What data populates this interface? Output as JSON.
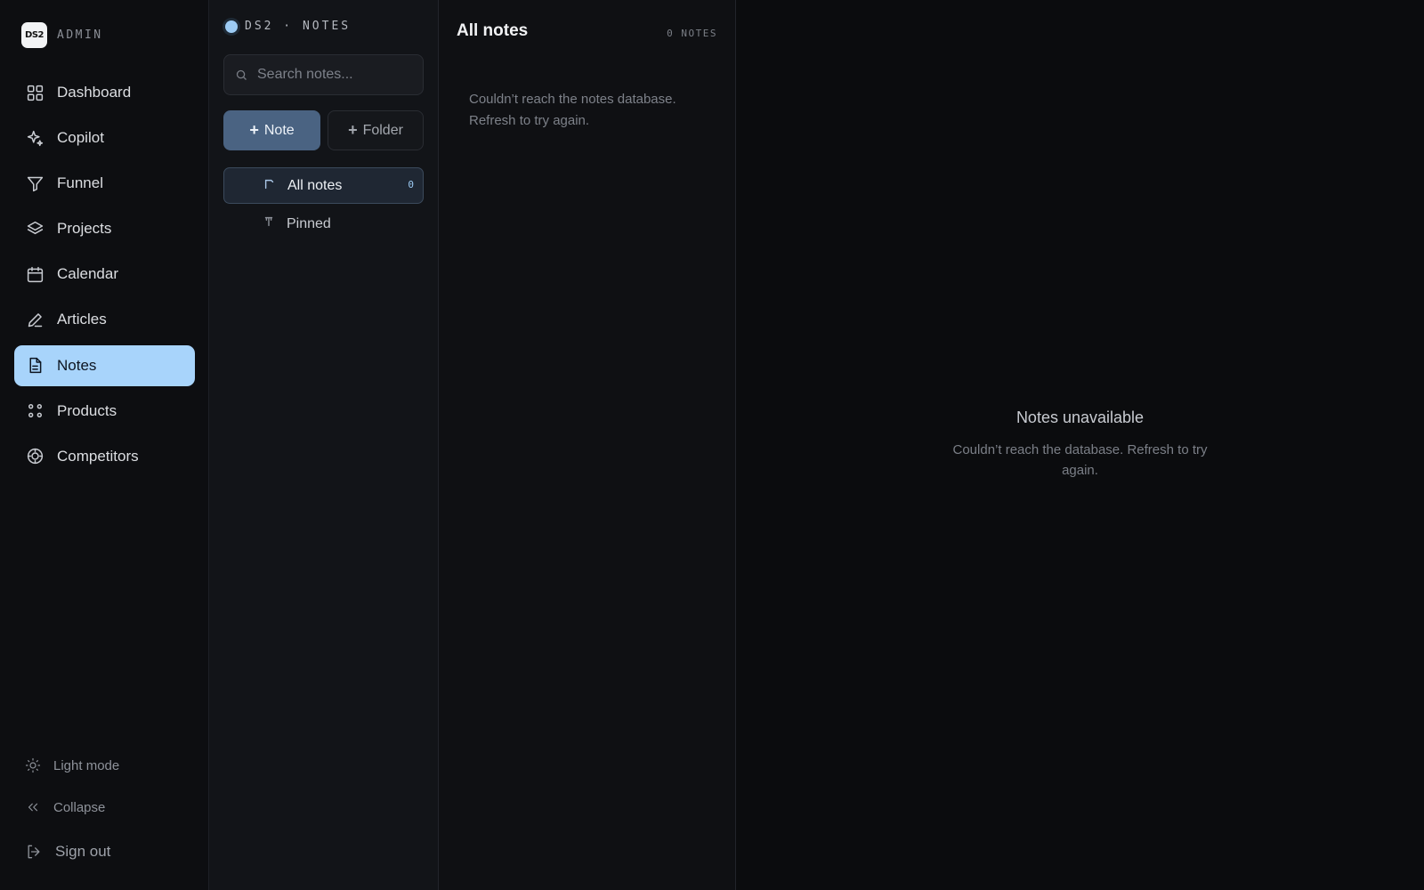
{
  "brand": {
    "logo_text": "DS2",
    "label": "ADMIN"
  },
  "nav": {
    "items": [
      {
        "label": "Dashboard",
        "icon": "grid-icon"
      },
      {
        "label": "Copilot",
        "icon": "sparkle-icon"
      },
      {
        "label": "Funnel",
        "icon": "funnel-icon"
      },
      {
        "label": "Projects",
        "icon": "layers-icon"
      },
      {
        "label": "Calendar",
        "icon": "calendar-icon"
      },
      {
        "label": "Articles",
        "icon": "pen-icon"
      },
      {
        "label": "Notes",
        "icon": "document-icon",
        "active": true
      },
      {
        "label": "Products",
        "icon": "dots-icon"
      },
      {
        "label": "Competitors",
        "icon": "target-icon"
      }
    ],
    "active_color": "#a8d4fb"
  },
  "footer": {
    "light_mode": "Light mode",
    "collapse": "Collapse",
    "sign_out": "Sign out"
  },
  "folders_panel": {
    "section_title": "DS2 · NOTES",
    "search_placeholder": "Search notes...",
    "new_note_label": "Note",
    "new_folder_label": "Folder",
    "folders": [
      {
        "label": "All notes",
        "count": "0",
        "active": true
      },
      {
        "label": "Pinned"
      }
    ]
  },
  "list_panel": {
    "title": "All notes",
    "count_label": "0 NOTES",
    "error_message": "Couldn’t reach the notes database. Refresh to try again."
  },
  "detail_panel": {
    "title": "Notes unavailable",
    "message": "Couldn’t reach the database. Refresh to try again."
  }
}
